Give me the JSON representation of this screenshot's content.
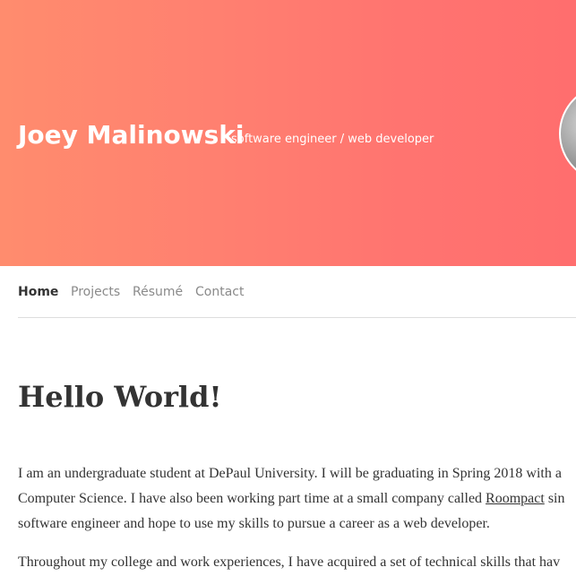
{
  "header": {
    "site_title": "Joey Malinowski",
    "tagline": "software engineer / web developer",
    "hero_gradient_start": "#ff8c6e",
    "hero_gradient_end": "#ff6e6e"
  },
  "nav": {
    "items": [
      {
        "label": "Home",
        "active": true
      },
      {
        "label": "Projects",
        "active": false
      },
      {
        "label": "Résumé",
        "active": false
      },
      {
        "label": "Contact",
        "active": false
      }
    ]
  },
  "main": {
    "heading": "Hello World!",
    "para1": {
      "line1": "I am an undergraduate student at DePaul University. I will be graduating in Spring 2018 with a",
      "line2_before": "Computer Science. I have also been working part time at a small company called ",
      "link": "Roompact",
      "line2_after": " sin",
      "line3": "software engineer and hope to use my skills to pursue a career as a web developer."
    },
    "para2": {
      "line1": "Throughout my college and work experiences, I have acquired a set of technical skills that hav"
    }
  }
}
